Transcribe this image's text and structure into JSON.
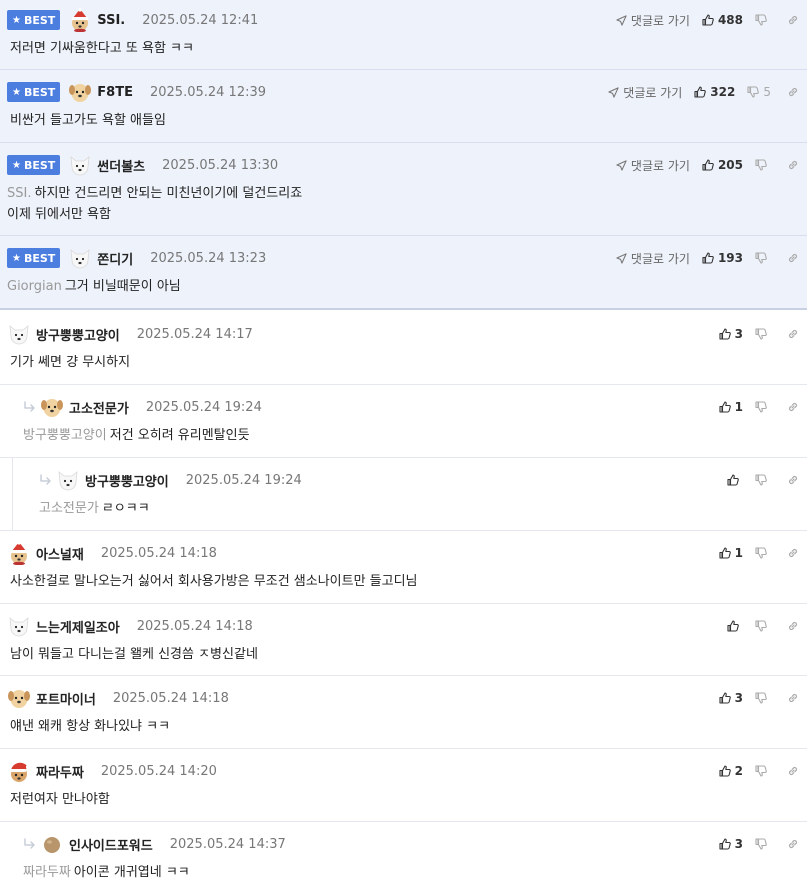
{
  "labels": {
    "best": "BEST",
    "reply_to": "댓글로 가기"
  },
  "colors": {
    "best_badge": "#4c7ee0",
    "best_bg": "#eef2fb",
    "divider": "#e4e7ee"
  },
  "comments": [
    {
      "best": true,
      "avatar": "puppy-santa-icon",
      "nick": "SSI.",
      "time": "2025.05.24 12:41",
      "likes": "488",
      "dislikes": "",
      "mention": "",
      "text": "저러면 기싸움한다고 또 욕함 ㅋㅋ",
      "reply_level": 0
    },
    {
      "best": true,
      "avatar": "puppy-icon",
      "nick": "F8TE",
      "time": "2025.05.24 12:39",
      "likes": "322",
      "dislikes": "5",
      "mention": "",
      "text": "비싼거 들고가도 욕할 애들임",
      "reply_level": 0
    },
    {
      "best": true,
      "avatar": "white-dog-icon",
      "nick": "썬더볼츠",
      "time": "2025.05.24 13:30",
      "likes": "205",
      "dislikes": "",
      "mention": "SSI.",
      "text": "하지만 건드리면 안되는 미친년이기에 덜건드리죠\n이제 뒤에서만 욕함",
      "reply_level": 0
    },
    {
      "best": true,
      "avatar": "white-dog-icon",
      "nick": "쫀디기",
      "time": "2025.05.24 13:23",
      "likes": "193",
      "dislikes": "",
      "mention": "Giorgian",
      "text": "그거 비닐때문이 아님",
      "reply_level": 0
    },
    {
      "best": false,
      "avatar": "white-dog-icon",
      "nick": "방구뿡뿡고양이",
      "time": "2025.05.24 14:17",
      "likes": "3",
      "dislikes": "",
      "mention": "",
      "text": "기가 쎄면 걍 무시하지",
      "reply_level": 0
    },
    {
      "best": false,
      "avatar": "puppy-icon",
      "nick": "고소전문가",
      "time": "2025.05.24 19:24",
      "likes": "1",
      "dislikes": "",
      "mention": "방구뿡뿡고양이",
      "text": "저건 오히려 유리멘탈인듯",
      "reply_level": 1
    },
    {
      "best": false,
      "avatar": "white-dog-icon",
      "nick": "방구뿡뿡고양이",
      "time": "2025.05.24 19:24",
      "likes": "",
      "dislikes": "",
      "mention": "고소전문가",
      "text": "ㄹㅇㅋㅋ",
      "reply_level": 2
    },
    {
      "best": false,
      "avatar": "puppy-santa-icon",
      "nick": "아스널재",
      "time": "2025.05.24 14:18",
      "likes": "1",
      "dislikes": "",
      "mention": "",
      "text": "사소한걸로 말나오는거 싫어서 회사용가방은 무조건 샘소나이트만 들고디님",
      "reply_level": 0
    },
    {
      "best": false,
      "avatar": "white-dog-icon",
      "nick": "느는게제일조아",
      "time": "2025.05.24 14:18",
      "likes": "",
      "dislikes": "",
      "mention": "",
      "text": "남이 뭐들고 다니는걸 왤케 신경씀 ㅈ병신같네",
      "reply_level": 0
    },
    {
      "best": false,
      "avatar": "puppy-icon",
      "nick": "포트마이너",
      "time": "2025.05.24 14:18",
      "likes": "3",
      "dislikes": "",
      "mention": "",
      "text": "얘낸 왜캐 항상 화나있냐 ㅋㅋ",
      "reply_level": 0
    },
    {
      "best": false,
      "avatar": "santa-dog-icon",
      "nick": "짜라두짜",
      "time": "2025.05.24 14:20",
      "likes": "2",
      "dislikes": "",
      "mention": "",
      "text": "저런여자 만나야함",
      "reply_level": 0
    },
    {
      "best": false,
      "avatar": "brown-ball-icon",
      "nick": "인사이드포워드",
      "time": "2025.05.24 14:37",
      "likes": "3",
      "dislikes": "",
      "mention": "짜라두짜",
      "text": "아이콘 개귀엽네 ㅋㅋ",
      "reply_level": 1
    }
  ]
}
